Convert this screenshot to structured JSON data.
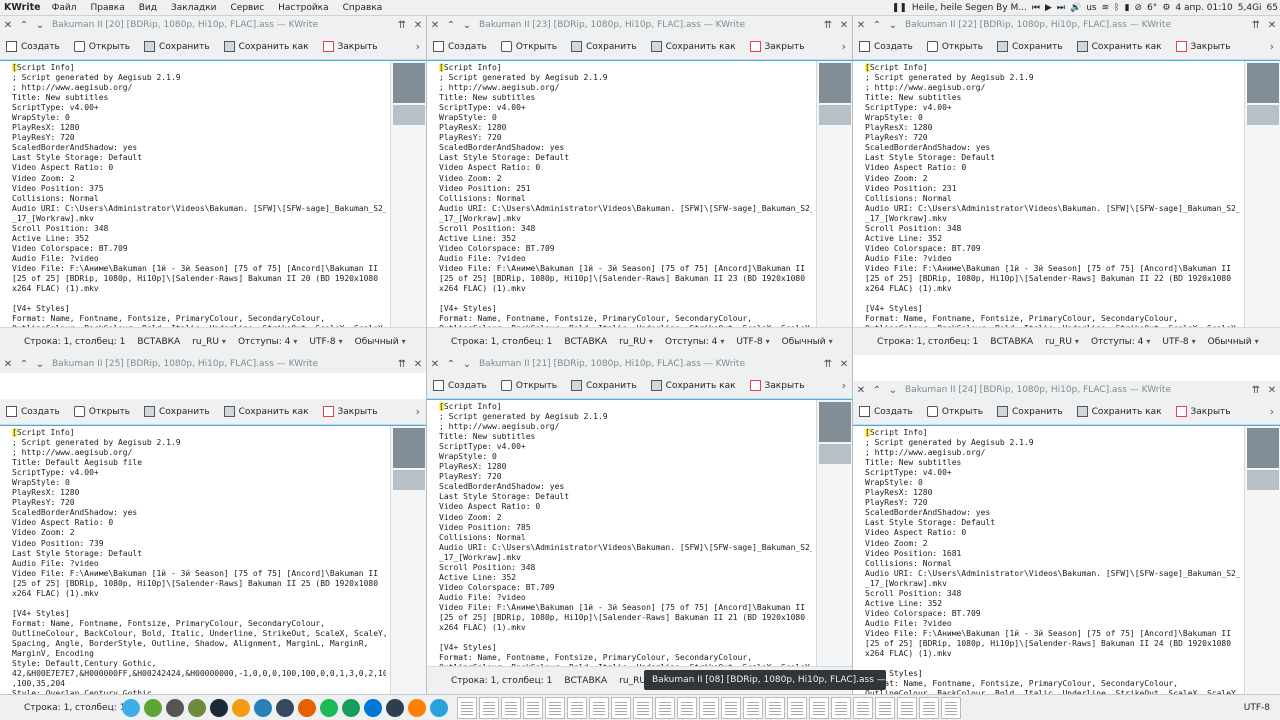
{
  "topbar": {
    "app_name": "KWrite",
    "menu": [
      "Файл",
      "Правка",
      "Вид",
      "Закладки",
      "Сервис",
      "Настройка",
      "Справка"
    ],
    "media": "Heile, heile Segen By M...",
    "keyboard": "us",
    "weather": "6°",
    "datetime": "4 апр. 01:10",
    "disk": "5,4Gi",
    "extra": "65"
  },
  "toolbar": {
    "new": "Создать",
    "open": "Открыть",
    "save": "Сохранить",
    "save_as": "Сохранить как",
    "close": "Закрыть"
  },
  "status": {
    "position": "Строка: 1, столбец: 1",
    "mode": "ВСТАВКА",
    "lang": "ru_RU",
    "indent": "Отступы: 4",
    "encoding": "UTF-8",
    "eol": "Обычный"
  },
  "windows": [
    {
      "title": "Bakuman II [20] [BDRip, 1080p, Hi10p, FLAC].ass — KWrite",
      "lines": [
        "[Script Info]",
        "; Script generated by Aegisub 2.1.9",
        "; http://www.aegisub.org/",
        "Title: New subtitles",
        "ScriptType: v4.00+",
        "WrapStyle: 0",
        "PlayResX: 1280",
        "PlayResY: 720",
        "ScaledBorderAndShadow: yes",
        "Last Style Storage: Default",
        "Video Aspect Ratio: 0",
        "Video Zoom: 2",
        "Video Position: 375",
        "Collisions: Normal",
        "Audio URI: C:\\Users\\Administrator\\Videos\\Bakuman. [SFW]\\[SFW-sage]_Bakuman_S2_-",
        "_17_[Workraw].mkv",
        "Scroll Position: 348",
        "Active Line: 352",
        "Video Colorspace: BT.709",
        "Audio File: ?video",
        "Video File: F:\\Аниме\\Bakuman [1й - 3й Season] [75 of 75] [Ancord]\\Bakuman II",
        "[25 of 25] [BDRip, 1080p, Hi10p]\\[Salender-Raws] Bakuman II 20 (BD 1920x1080",
        "x264 FLAC) (1).mkv",
        "",
        "[V4+ Styles]",
        "Format: Name, Fontname, Fontsize, PrimaryColour, SecondaryColour,",
        "OutlineColour, BackColour, Bold, Italic, Underline, StrikeOut, ScaleX, ScaleY,"
      ]
    },
    {
      "title": "Bakuman II [23] [BDRip, 1080p, Hi10p, FLAC].ass — KWrite",
      "lines": [
        "[Script Info]",
        "; Script generated by Aegisub 2.1.9",
        "; http://www.aegisub.org/",
        "Title: New subtitles",
        "ScriptType: v4.00+",
        "WrapStyle: 0",
        "PlayResX: 1280",
        "PlayResY: 720",
        "ScaledBorderAndShadow: yes",
        "Last Style Storage: Default",
        "Video Aspect Ratio: 0",
        "Video Zoom: 2",
        "Video Position: 251",
        "Collisions: Normal",
        "Audio URI: C:\\Users\\Administrator\\Videos\\Bakuman. [SFW]\\[SFW-sage]_Bakuman_S2_-",
        "_17_[Workraw].mkv",
        "Scroll Position: 348",
        "Active Line: 352",
        "Video Colorspace: BT.709",
        "Audio File: ?video",
        "Video File: F:\\Аниме\\Bakuman [1й - 3й Season] [75 of 75] [Ancord]\\Bakuman II",
        "[25 of 25] [BDRip, 1080p, Hi10p]\\[Salender-Raws] Bakuman II 23 (BD 1920x1080",
        "x264 FLAC) (1).mkv",
        "",
        "[V4+ Styles]",
        "Format: Name, Fontname, Fontsize, PrimaryColour, SecondaryColour,",
        "OutlineColour, BackColour, Bold, Italic, Underline, StrikeOut, ScaleX, ScaleY,"
      ]
    },
    {
      "title": "Bakuman II [22] [BDRip, 1080p, Hi10p, FLAC].ass — KWrite",
      "lines": [
        "[Script Info]",
        "; Script generated by Aegisub 2.1.9",
        "; http://www.aegisub.org/",
        "Title: New subtitles",
        "ScriptType: v4.00+",
        "WrapStyle: 0",
        "PlayResX: 1280",
        "PlayResY: 720",
        "ScaledBorderAndShadow: yes",
        "Last Style Storage: Default",
        "Video Aspect Ratio: 0",
        "Video Zoom: 2",
        "Video Position: 231",
        "Collisions: Normal",
        "Audio URI: C:\\Users\\Administrator\\Videos\\Bakuman. [SFW]\\[SFW-sage]_Bakuman_S2_-",
        "_17_[Workraw].mkv",
        "Scroll Position: 348",
        "Active Line: 352",
        "Video Colorspace: BT.709",
        "Audio File: ?video",
        "Video File: F:\\Аниме\\Bakuman [1й - 3й Season] [75 of 75] [Ancord]\\Bakuman II",
        "[25 of 25] [BDRip, 1080p, Hi10p]\\[Salender-Raws] Bakuman II 22 (BD 1920x1080",
        "x264 FLAC) (1).mkv",
        "",
        "[V4+ Styles]",
        "Format: Name, Fontname, Fontsize, PrimaryColour, SecondaryColour,",
        "OutlineColour, BackColour, Bold, Italic, Underline, StrikeOut, ScaleX, ScaleY,"
      ]
    },
    {
      "title": "Bakuman II [25] [BDRip, 1080p, Hi10p, FLAC].ass — KWrite",
      "lines": [
        "[Script Info]",
        "; Script generated by Aegisub 2.1.9",
        "; http://www.aegisub.org/",
        "Title: Default Aegisub file",
        "ScriptType: v4.00+",
        "WrapStyle: 0",
        "PlayResX: 1280",
        "PlayResY: 720",
        "ScaledBorderAndShadow: yes",
        "Video Aspect Ratio: 0",
        "Video Zoom: 2",
        "Video Position: 739",
        "Last Style Storage: Default",
        "Audio File: ?video",
        "Video File: F:\\Аниме\\Bakuman [1й - 3й Season] [75 of 75] [Ancord]\\Bakuman II",
        "[25 of 25] [BDRip, 1080p, Hi10p]\\[Salender-Raws] Bakuman II 25 (BD 1920x1080",
        "x264 FLAC) (1).mkv",
        "",
        "[V4+ Styles]",
        "Format: Name, Fontname, Fontsize, PrimaryColour, SecondaryColour,",
        "OutlineColour, BackColour, Bold, Italic, Underline, StrikeOut, ScaleX, ScaleY,",
        "Spacing, Angle, BorderStyle, Outline, Shadow, Alignment, MarginL, MarginR,",
        "MarginV, Encoding",
        "Style: Default,Century Gothic,",
        "42,&H00E7E7E7,&H000000FF,&H00242424,&H00000000,-1,0,0,0,100,100,0,0,1,3,0,2,100",
        ",100,35,204",
        "Style: Overlap,Century Gothic,"
      ]
    },
    {
      "title": "Bakuman II [21] [BDRip, 1080p, Hi10p, FLAC].ass — KWrite",
      "lines": [
        "[Script Info]",
        "; Script generated by Aegisub 2.1.9",
        "; http://www.aegisub.org/",
        "Title: New subtitles",
        "ScriptType: v4.00+",
        "WrapStyle: 0",
        "PlayResX: 1280",
        "PlayResY: 720",
        "ScaledBorderAndShadow: yes",
        "Last Style Storage: Default",
        "Video Aspect Ratio: 0",
        "Video Zoom: 2",
        "Video Position: 785",
        "Collisions: Normal",
        "Audio URI: C:\\Users\\Administrator\\Videos\\Bakuman. [SFW]\\[SFW-sage]_Bakuman_S2_-",
        "_17_[Workraw].mkv",
        "Scroll Position: 348",
        "Active Line: 352",
        "Video Colorspace: BT.709",
        "Audio File: ?video",
        "Video File: F:\\Аниме\\Bakuman [1й - 3й Season] [75 of 75] [Ancord]\\Bakuman II",
        "[25 of 25] [BDRip, 1080p, Hi10p]\\[Salender-Raws] Bakuman II 21 (BD 1920x1080",
        "x264 FLAC) (1).mkv",
        "",
        "[V4+ Styles]",
        "Format: Name, Fontname, Fontsize, PrimaryColour, SecondaryColour,",
        "OutlineColour, BackColour, Bold, Italic, Underline, StrikeOut, ScaleX, ScaleY,"
      ]
    },
    {
      "title": "Bakuman II [24] [BDRip, 1080p, Hi10p, FLAC].ass — KWrite",
      "lines": [
        "[Script Info]",
        "; Script generated by Aegisub 2.1.9",
        "; http://www.aegisub.org/",
        "Title: New subtitles",
        "ScriptType: v4.00+",
        "WrapStyle: 0",
        "PlayResX: 1280",
        "PlayResY: 720",
        "ScaledBorderAndShadow: yes",
        "Last Style Storage: Default",
        "Video Aspect Ratio: 0",
        "Video Zoom: 2",
        "Video Position: 1681",
        "Collisions: Normal",
        "Audio URI: C:\\Users\\Administrator\\Videos\\Bakuman. [SFW]\\[SFW-sage]_Bakuman_S2_-",
        "_17_[Workraw].mkv",
        "Scroll Position: 348",
        "Active Line: 352",
        "Video Colorspace: BT.709",
        "Audio File: ?video",
        "Video File: F:\\Аниме\\Bakuman [1й - 3й Season] [75 of 75] [Ancord]\\Bakuman II",
        "[25 of 25] [BDRip, 1080p, Hi10p]\\[Salender-Raws] Bakuman II 24 (BD 1920x1080",
        "x264 FLAC) (1).mkv",
        "",
        "[V4+ Styles]",
        "Format: Name, Fontname, Fontsize, PrimaryColour, SecondaryColour,",
        "OutlineColour, BackColour, Bold, Italic, Underline, StrikeOut, ScaleX, ScaleY,"
      ]
    }
  ],
  "taskbar": {
    "left_status": "Строка: 1, столбец: 1",
    "right_status": "UTF-8"
  },
  "tooltip": "Bakuman II [08] [BDRip, 1080p, Hi10p, FLAC].ass — KWrite",
  "colors": {
    "accent": "#3daee9",
    "highlight": "#fdf35b",
    "close_icon": "#da4453"
  }
}
